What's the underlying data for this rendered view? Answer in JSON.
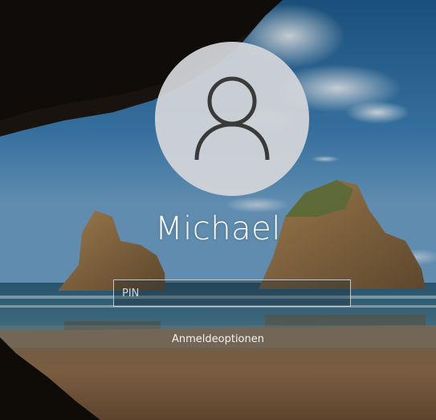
{
  "login": {
    "user_name": "Michael",
    "pin_placeholder": "PIN",
    "sign_in_options_label": "Anmeldeoptionen",
    "avatar_icon": "user-icon"
  },
  "colors": {
    "text": "#ffffff",
    "avatar_bg": "#d4d6d9",
    "avatar_icon": "#3a3a3a",
    "input_border": "#dcdcdc"
  }
}
